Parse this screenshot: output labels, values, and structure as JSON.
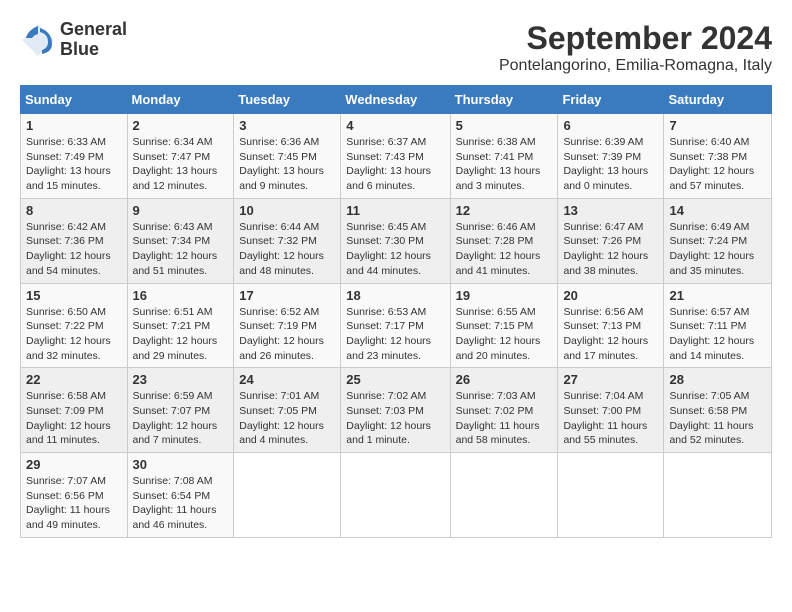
{
  "header": {
    "logo_line1": "General",
    "logo_line2": "Blue",
    "title": "September 2024",
    "subtitle": "Pontelangorino, Emilia-Romagna, Italy"
  },
  "days_of_week": [
    "Sunday",
    "Monday",
    "Tuesday",
    "Wednesday",
    "Thursday",
    "Friday",
    "Saturday"
  ],
  "weeks": [
    [
      {
        "day": "1",
        "info": "Sunrise: 6:33 AM\nSunset: 7:49 PM\nDaylight: 13 hours and 15 minutes."
      },
      {
        "day": "2",
        "info": "Sunrise: 6:34 AM\nSunset: 7:47 PM\nDaylight: 13 hours and 12 minutes."
      },
      {
        "day": "3",
        "info": "Sunrise: 6:36 AM\nSunset: 7:45 PM\nDaylight: 13 hours and 9 minutes."
      },
      {
        "day": "4",
        "info": "Sunrise: 6:37 AM\nSunset: 7:43 PM\nDaylight: 13 hours and 6 minutes."
      },
      {
        "day": "5",
        "info": "Sunrise: 6:38 AM\nSunset: 7:41 PM\nDaylight: 13 hours and 3 minutes."
      },
      {
        "day": "6",
        "info": "Sunrise: 6:39 AM\nSunset: 7:39 PM\nDaylight: 13 hours and 0 minutes."
      },
      {
        "day": "7",
        "info": "Sunrise: 6:40 AM\nSunset: 7:38 PM\nDaylight: 12 hours and 57 minutes."
      }
    ],
    [
      {
        "day": "8",
        "info": "Sunrise: 6:42 AM\nSunset: 7:36 PM\nDaylight: 12 hours and 54 minutes."
      },
      {
        "day": "9",
        "info": "Sunrise: 6:43 AM\nSunset: 7:34 PM\nDaylight: 12 hours and 51 minutes."
      },
      {
        "day": "10",
        "info": "Sunrise: 6:44 AM\nSunset: 7:32 PM\nDaylight: 12 hours and 48 minutes."
      },
      {
        "day": "11",
        "info": "Sunrise: 6:45 AM\nSunset: 7:30 PM\nDaylight: 12 hours and 44 minutes."
      },
      {
        "day": "12",
        "info": "Sunrise: 6:46 AM\nSunset: 7:28 PM\nDaylight: 12 hours and 41 minutes."
      },
      {
        "day": "13",
        "info": "Sunrise: 6:47 AM\nSunset: 7:26 PM\nDaylight: 12 hours and 38 minutes."
      },
      {
        "day": "14",
        "info": "Sunrise: 6:49 AM\nSunset: 7:24 PM\nDaylight: 12 hours and 35 minutes."
      }
    ],
    [
      {
        "day": "15",
        "info": "Sunrise: 6:50 AM\nSunset: 7:22 PM\nDaylight: 12 hours and 32 minutes."
      },
      {
        "day": "16",
        "info": "Sunrise: 6:51 AM\nSunset: 7:21 PM\nDaylight: 12 hours and 29 minutes."
      },
      {
        "day": "17",
        "info": "Sunrise: 6:52 AM\nSunset: 7:19 PM\nDaylight: 12 hours and 26 minutes."
      },
      {
        "day": "18",
        "info": "Sunrise: 6:53 AM\nSunset: 7:17 PM\nDaylight: 12 hours and 23 minutes."
      },
      {
        "day": "19",
        "info": "Sunrise: 6:55 AM\nSunset: 7:15 PM\nDaylight: 12 hours and 20 minutes."
      },
      {
        "day": "20",
        "info": "Sunrise: 6:56 AM\nSunset: 7:13 PM\nDaylight: 12 hours and 17 minutes."
      },
      {
        "day": "21",
        "info": "Sunrise: 6:57 AM\nSunset: 7:11 PM\nDaylight: 12 hours and 14 minutes."
      }
    ],
    [
      {
        "day": "22",
        "info": "Sunrise: 6:58 AM\nSunset: 7:09 PM\nDaylight: 12 hours and 11 minutes."
      },
      {
        "day": "23",
        "info": "Sunrise: 6:59 AM\nSunset: 7:07 PM\nDaylight: 12 hours and 7 minutes."
      },
      {
        "day": "24",
        "info": "Sunrise: 7:01 AM\nSunset: 7:05 PM\nDaylight: 12 hours and 4 minutes."
      },
      {
        "day": "25",
        "info": "Sunrise: 7:02 AM\nSunset: 7:03 PM\nDaylight: 12 hours and 1 minute."
      },
      {
        "day": "26",
        "info": "Sunrise: 7:03 AM\nSunset: 7:02 PM\nDaylight: 11 hours and 58 minutes."
      },
      {
        "day": "27",
        "info": "Sunrise: 7:04 AM\nSunset: 7:00 PM\nDaylight: 11 hours and 55 minutes."
      },
      {
        "day": "28",
        "info": "Sunrise: 7:05 AM\nSunset: 6:58 PM\nDaylight: 11 hours and 52 minutes."
      }
    ],
    [
      {
        "day": "29",
        "info": "Sunrise: 7:07 AM\nSunset: 6:56 PM\nDaylight: 11 hours and 49 minutes."
      },
      {
        "day": "30",
        "info": "Sunrise: 7:08 AM\nSunset: 6:54 PM\nDaylight: 11 hours and 46 minutes."
      },
      {
        "day": "",
        "info": ""
      },
      {
        "day": "",
        "info": ""
      },
      {
        "day": "",
        "info": ""
      },
      {
        "day": "",
        "info": ""
      },
      {
        "day": "",
        "info": ""
      }
    ]
  ]
}
